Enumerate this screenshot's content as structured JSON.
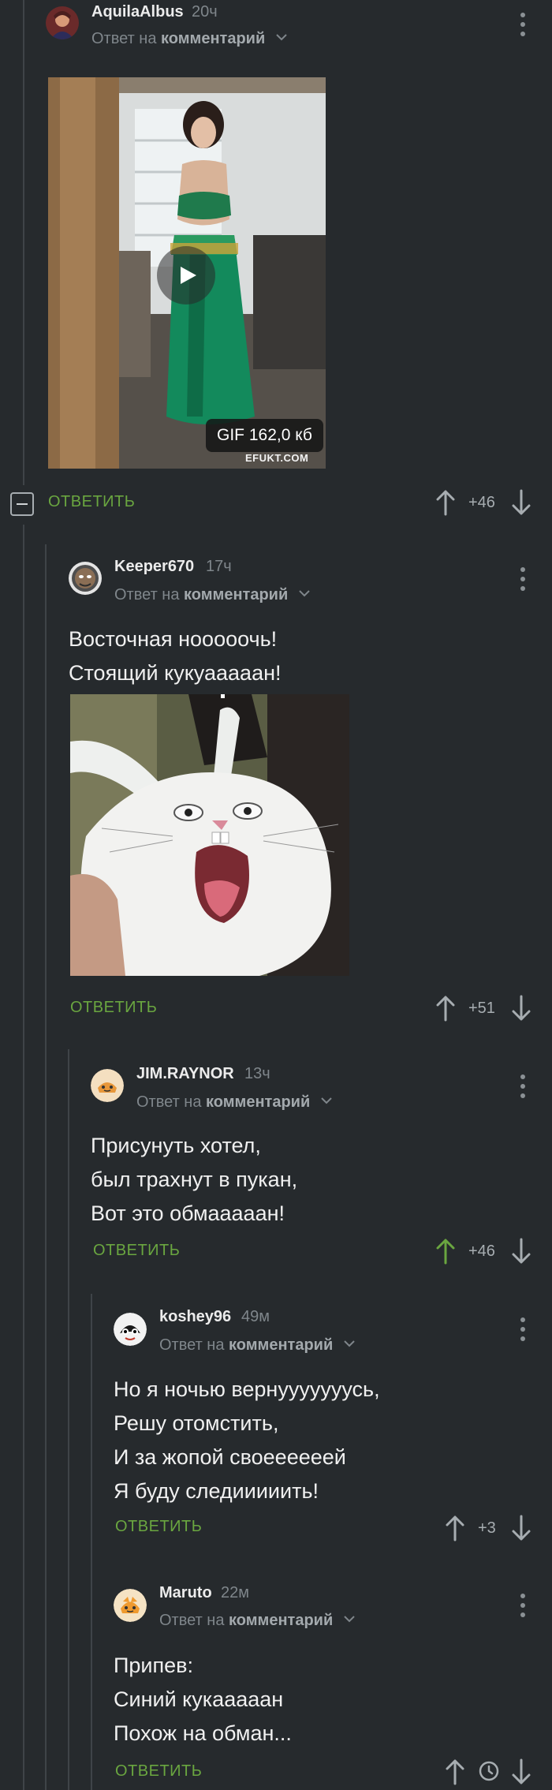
{
  "comments": [
    {
      "username": "AquilaAlbus",
      "time": "20ч",
      "reply_prefix": "Ответ на",
      "reply_link": "комментарий",
      "media": {
        "badge": "GIF 162,0 кб",
        "watermark": "EFUKT.COM"
      },
      "reply_label": "ОТВЕТИТЬ",
      "rating": "+46"
    },
    {
      "username": "Keeper670",
      "time": "17ч",
      "reply_prefix": "Ответ на",
      "reply_link": "комментарий",
      "lines": [
        "Восточная нооооочь!",
        "Стоящий кукуааааан!"
      ],
      "reply_label": "ОТВЕТИТЬ",
      "rating": "+51"
    },
    {
      "username": "JIM.RAYNOR",
      "time": "13ч",
      "reply_prefix": "Ответ на",
      "reply_link": "комментарий",
      "lines": [
        "Присунуть хотел,",
        "был трахнут в пукан,",
        "Вот это обмааааан!"
      ],
      "reply_label": "ОТВЕТИТЬ",
      "rating": "+46",
      "upvoted": true
    },
    {
      "username": "koshey96",
      "time": "49м",
      "reply_prefix": "Ответ на",
      "reply_link": "комментарий",
      "lines": [
        "Но я ночью вернууууууусь,",
        "Решу отомстить,",
        "И за жопой своеееееей",
        "Я буду следииииить!"
      ],
      "reply_label": "ОТВЕТИТЬ",
      "rating": "+3"
    },
    {
      "username": "Maruto",
      "time": "22м",
      "reply_prefix": "Ответ на",
      "reply_link": "комментарий",
      "lines": [
        "Припев:",
        "Синий кукааааан",
        "Похож на обман..."
      ],
      "reply_label": "ОТВЕТИТЬ"
    }
  ],
  "icons": {
    "upvote": "arrow-up-icon",
    "downvote": "arrow-down-icon",
    "more": "more-vertical-icon",
    "pending_rating": "clock-icon",
    "collapse": "collapse-minus-icon",
    "play": "play-icon"
  },
  "colors": {
    "background": "#262a2d",
    "accent_green": "#6aa640",
    "muted_text": "#7f868b",
    "thread_line": "#3f4448"
  }
}
